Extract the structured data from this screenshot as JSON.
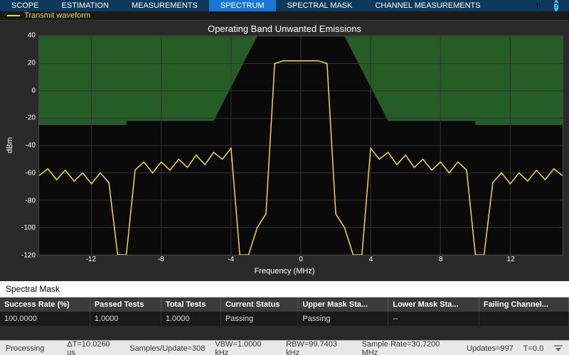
{
  "tabs": {
    "scope": "SCOPE",
    "estimation": "ESTIMATION",
    "measurements": "MEASUREMENTS",
    "spectrum": "SPECTRUM",
    "spectral_mask": "SPECTRAL MASK",
    "channel_measurements": "CHANNEL MEASUREMENTS",
    "help": "?"
  },
  "legend": {
    "transmit": "Transmit waveform"
  },
  "chart": {
    "title": "Operating Band Unwanted Emissions",
    "ylabel": "dBm",
    "xlabel": "Frequency (MHz)"
  },
  "mask": {
    "header": "Spectral Mask",
    "cols": {
      "success": "Success Rate (%)",
      "passed": "Passed Tests",
      "total": "Total Tests",
      "status": "Current Status",
      "upper": "Upper Mask Sta...",
      "lower": "Lower Mask Sta...",
      "failing": "Failing Channel..."
    },
    "row": {
      "success": "100.0000",
      "passed": "1.0000",
      "total": "1.0000",
      "status": "Passing",
      "upper": "Passing",
      "lower": "--",
      "failing": ""
    }
  },
  "status": {
    "processing": "Processing",
    "dt": "ΔT=10.0260 us",
    "samples": "Samples/Update=308",
    "vbw": "VBW=1.0000 kHz",
    "rbw": "RBW=99.7403 kHz",
    "rate": "Sample Rate=30.7200 MHz",
    "updates": "Updates=997",
    "t": "T=0.0"
  },
  "chart_data": {
    "type": "line",
    "title": "Operating Band Unwanted Emissions",
    "xlabel": "Frequency (MHz)",
    "ylabel": "dBm",
    "xlim": [
      -15,
      15
    ],
    "ylim": [
      -120,
      40
    ],
    "xticks": [
      -12,
      -8,
      -4,
      0,
      4,
      8,
      12
    ],
    "yticks": [
      -120,
      -100,
      -80,
      -60,
      -40,
      -20,
      0,
      20,
      40
    ],
    "series": [
      {
        "name": "Transmit waveform",
        "color": "#e8d457",
        "x": [
          -15,
          -14.5,
          -14,
          -13.5,
          -13,
          -12.5,
          -12,
          -11.5,
          -11,
          -10.5,
          -10,
          -9.5,
          -9,
          -8.5,
          -8,
          -7.5,
          -7,
          -6.5,
          -6,
          -5.5,
          -5,
          -4.5,
          -4,
          -3.5,
          -3,
          -2.5,
          -2,
          -1.5,
          -1,
          0,
          1,
          1.5,
          2,
          2.5,
          3,
          3.5,
          4,
          4.5,
          5,
          5.5,
          6,
          6.5,
          7,
          7.5,
          8,
          8.5,
          9,
          9.5,
          10,
          10.5,
          11,
          11.5,
          12,
          12.5,
          13,
          13.5,
          14,
          14.5,
          15
        ],
        "y": [
          -62,
          -57,
          -65,
          -58,
          -66,
          -60,
          -68,
          -60,
          -67,
          -120,
          -120,
          -58,
          -52,
          -60,
          -52,
          -58,
          -50,
          -56,
          -47,
          -54,
          -45,
          -50,
          -42,
          -120,
          -120,
          -100,
          -90,
          20,
          22,
          22,
          22,
          20,
          -90,
          -100,
          -120,
          -120,
          -42,
          -50,
          -45,
          -54,
          -47,
          -56,
          -50,
          -58,
          -52,
          -60,
          -52,
          -58,
          -120,
          -120,
          -67,
          -60,
          -68,
          -60,
          -66,
          -58,
          -65,
          -57,
          -62
        ]
      }
    ],
    "mask_upper": {
      "color_fill": "#2c6b2c",
      "x": [
        -15,
        -10,
        -10,
        -5,
        -2.5,
        2.5,
        5,
        10,
        10,
        15
      ],
      "y": [
        -25,
        -25,
        -22,
        -22,
        40,
        40,
        -22,
        -22,
        -25,
        -25
      ]
    }
  }
}
